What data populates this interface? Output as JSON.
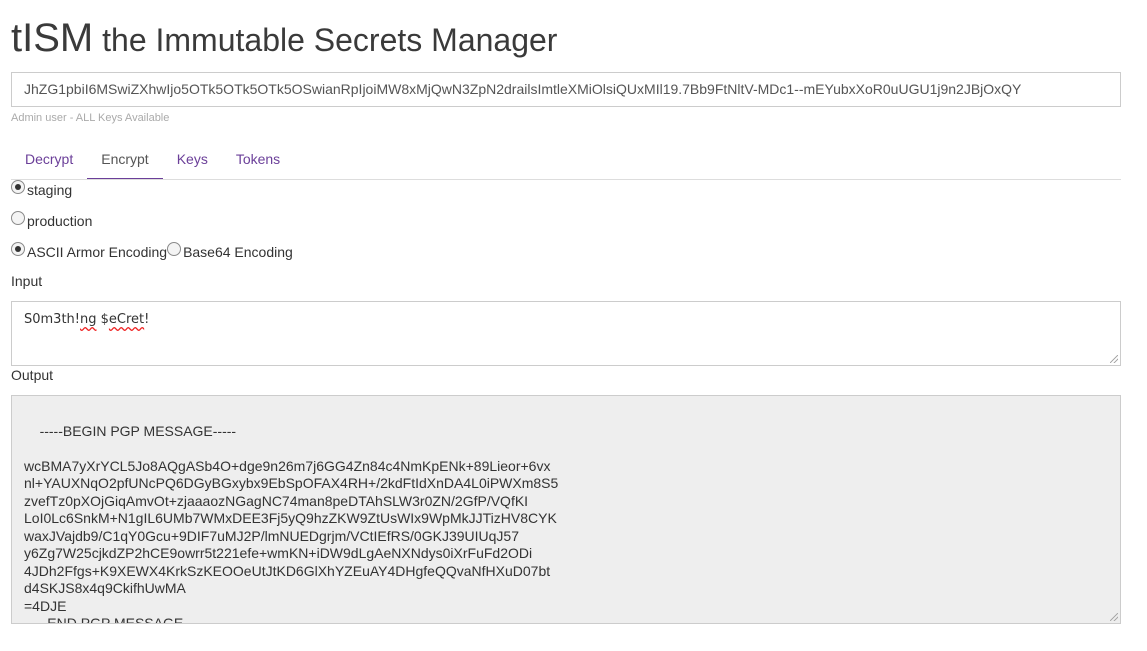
{
  "header": {
    "brand": "tISM",
    "subtitle": "the Immutable Secrets Manager"
  },
  "token": {
    "value": "JhZG1pbiI6MSwiZXhwIjo5OTk5OTk5OTk5OSwianRpIjoiMW8xMjQwN3ZpN2drailsImtleXMiOlsiQUxMIl19.7Bb9FtNltV-MDc1--mEYubxXoR0uUGU1j9n2JBjOxQY",
    "hint": "Admin user - ALL Keys Available"
  },
  "tabs": [
    {
      "label": "Decrypt",
      "active": false
    },
    {
      "label": "Encrypt",
      "active": true
    },
    {
      "label": "Keys",
      "active": false
    },
    {
      "label": "Tokens",
      "active": false
    }
  ],
  "environments": [
    {
      "label": "staging",
      "checked": true
    },
    {
      "label": "production",
      "checked": false
    }
  ],
  "encodings": [
    {
      "label": "ASCII Armor Encoding",
      "checked": true
    },
    {
      "label": "Base64 Encoding",
      "checked": false
    }
  ],
  "input": {
    "label": "Input",
    "parts": [
      "S0m3th!",
      "ng",
      " $",
      "eCret",
      "!"
    ]
  },
  "output": {
    "label": "Output",
    "value": "-----BEGIN PGP MESSAGE-----\n\nwcBMA7yXrYCL5Jo8AQgASb4O+dge9n26m7j6GG4Zn84c4NmKpENk+89Lieor+6vx\nnl+YAUXNqO2pfUNcPQ6DGyBGxybx9EbSpOFAX4RH+/2kdFtIdXnDA4L0iPWXm8S5\nzvefTz0pXOjGiqAmvOt+zjaaaozNGagNC74man8peDTAhSLW3r0ZN/2GfP/VQfKI\nLoI0Lc6SnkM+N1gIL6UMb7WMxDEE3Fj5yQ9hzZKW9ZtUsWIx9WpMkJJTizHV8CYK\nwaxJVajdb9/C1qY0Gcu+9DIF7uMJ2P/lmNUEDgrjm/VCtIEfRS/0GKJ39UIUqJ57\ny6Zg7W25cjkdZP2hCE9owrr5t221efe+wmKN+iDW9dLgAeNXNdys0iXrFuFd2ODi\n4JDh2Ffgs+K9XEWX4KrkSzKEOOeUtJtKD6GlXhYZEuAY4DHgfeQQvaNfHXuD07bt\nd4SKJS8x4q9CkifhUwMA\n=4DJE\n-----END PGP MESSAGE-----"
  }
}
